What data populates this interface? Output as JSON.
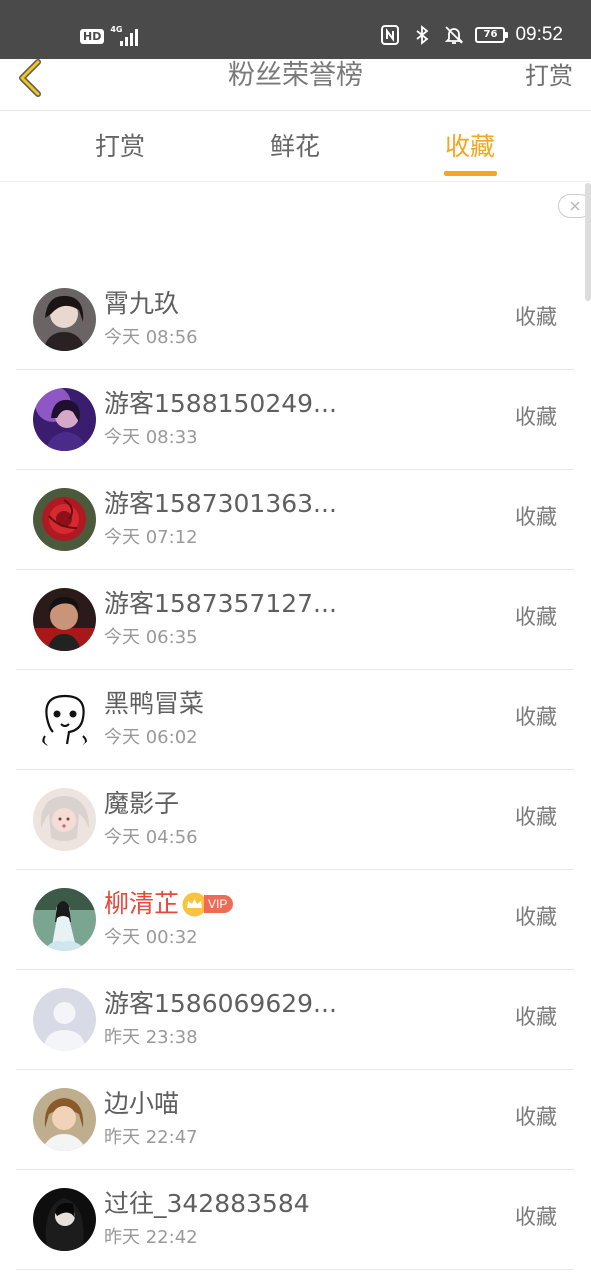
{
  "status_bar": {
    "hd": "HD",
    "network": "4G",
    "battery": "76",
    "time": "09:52",
    "icons": [
      "nfc-icon",
      "bluetooth-icon",
      "mute-bell-icon",
      "battery-icon"
    ]
  },
  "nav": {
    "title": "粉丝荣誉榜",
    "action": "打赏",
    "back_icon": "chevron-left-icon",
    "accent_color": "#f5a623"
  },
  "tabs": [
    {
      "label": "打赏",
      "active": false
    },
    {
      "label": "鲜花",
      "active": false
    },
    {
      "label": "收藏",
      "active": true
    }
  ],
  "ad": {
    "close_icon": "close-icon"
  },
  "fans": [
    {
      "name": "霄九玖",
      "time": "今天 08:56",
      "action": "收藏",
      "vip": false
    },
    {
      "name": "游客1588150249...",
      "time": "今天 08:33",
      "action": "收藏",
      "vip": false
    },
    {
      "name": "游客1587301363...",
      "time": "今天 07:12",
      "action": "收藏",
      "vip": false
    },
    {
      "name": "游客1587357127...",
      "time": "今天 06:35",
      "action": "收藏",
      "vip": false
    },
    {
      "name": "黑鸭冒菜",
      "time": "今天 06:02",
      "action": "收藏",
      "vip": false
    },
    {
      "name": "魔影子",
      "time": "今天 04:56",
      "action": "收藏",
      "vip": false
    },
    {
      "name": "柳清芷",
      "time": "今天 00:32",
      "action": "收藏",
      "vip": true,
      "vip_label": "VIP"
    },
    {
      "name": "游客1586069629...",
      "time": "昨天 23:38",
      "action": "收藏",
      "vip": false
    },
    {
      "name": "边小喵",
      "time": "昨天 22:47",
      "action": "收藏",
      "vip": false
    },
    {
      "name": "过往_342883584",
      "time": "昨天 22:42",
      "action": "收藏",
      "vip": false
    }
  ]
}
